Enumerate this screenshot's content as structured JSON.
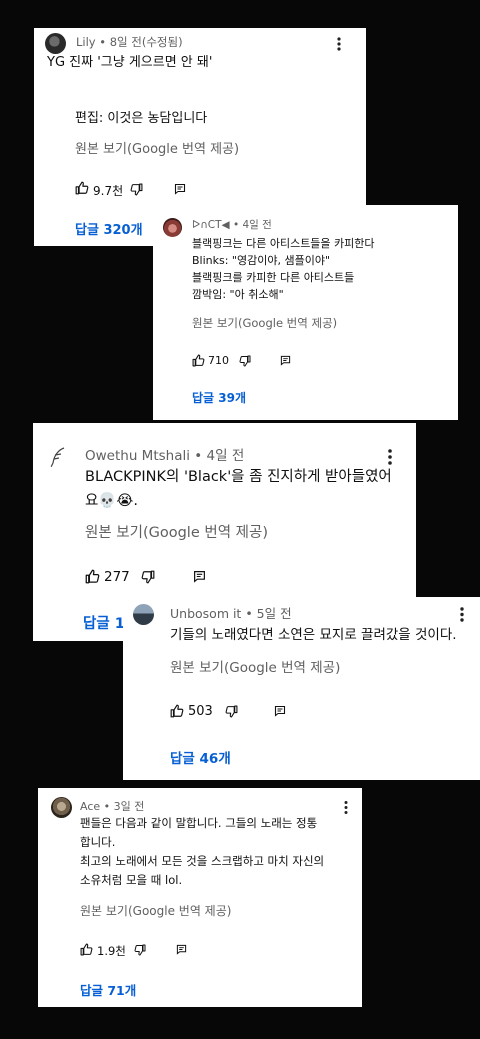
{
  "comments": [
    {
      "author": "Lily",
      "time": "• 8일 전(수정됨)",
      "lines": [
        "YG 진짜 '그냥 게으르면 안 돼'",
        "",
        "편집: 이것은 농담입니다"
      ],
      "translate": "원본 보기(Google 번역 제공)",
      "likes": "9.7천",
      "replies": "답글 320개"
    },
    {
      "author": "ᐅ∩CT◀",
      "time": "• 4일 전",
      "lines": [
        "블랙핑크는 다른 아티스트들을 카피한다",
        "Blinks: \"영감이야, 샘플이야\"",
        "블랙핑크를 카피한 다른 아티스트들",
        "깜박임: \"아 취소해\""
      ],
      "translate": "원본 보기(Google 번역 제공)",
      "likes": "710",
      "replies": "답글 39개"
    },
    {
      "author": "Owethu Mtshali",
      "time": "• 4일 전",
      "lines": [
        "BLACKPINK의 'Black'을 좀 진지하게 받아들였어",
        "요💀😭."
      ],
      "translate": "원본 보기(Google 번역 제공)",
      "likes": "277",
      "replies": "답글 1"
    },
    {
      "author": "Unbosom it",
      "time": "• 5일 전",
      "lines": [
        "기들의 노래였다면 소연은 묘지로 끌려갔을 것이다."
      ],
      "translate": "원본 보기(Google 번역 제공)",
      "likes": "503",
      "replies": "답글 46개"
    },
    {
      "author": "Ace",
      "time": "• 3일 전",
      "lines": [
        "팬들은 다음과 같이 말합니다. 그들의 노래는 정통",
        "합니다.",
        "최고의 노래에서 모든 것을 스크랩하고 마치 자신의",
        "소유처럼 모을 때 lol."
      ],
      "translate": "원본 보기(Google 번역 제공)",
      "likes": "1.9천",
      "replies": "답글 71개"
    }
  ],
  "icons": {
    "like": "thumb-up-icon",
    "dislike": "thumb-down-icon",
    "reply": "comment-reply-icon",
    "menu": "more-vert-icon"
  },
  "colors": {
    "background": "#070707",
    "card": "#ffffff",
    "reply_link": "#065fd4",
    "meta_text": "#606060"
  }
}
